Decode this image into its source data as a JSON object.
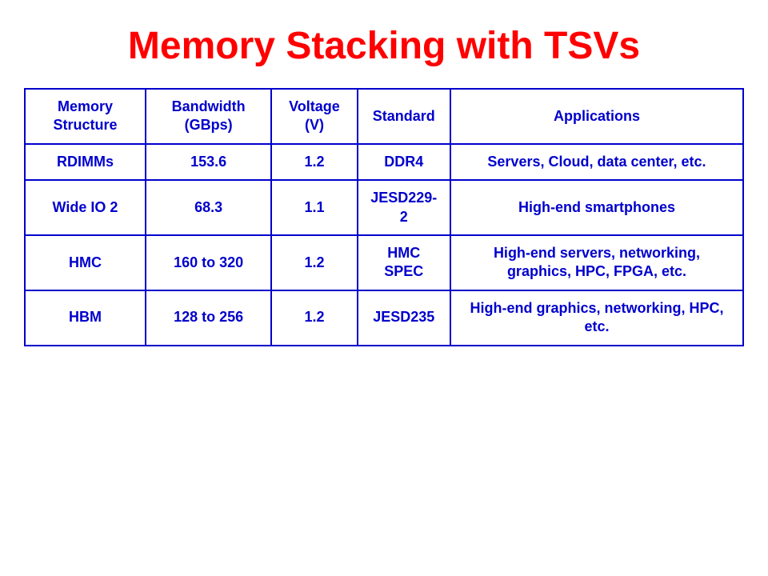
{
  "title": "Memory Stacking with TSVs",
  "table": {
    "headers": [
      "Memory Structure",
      "Bandwidth (GBps)",
      "Voltage (V)",
      "Standard",
      "Applications"
    ],
    "rows": [
      {
        "memory_structure": "RDIMMs",
        "bandwidth": "153.6",
        "voltage": "1.2",
        "standard": "DDR4",
        "applications": "Servers, Cloud, data center, etc."
      },
      {
        "memory_structure": "Wide IO 2",
        "bandwidth": "68.3",
        "voltage": "1.1",
        "standard": "JESD229-2",
        "applications": "High-end smartphones"
      },
      {
        "memory_structure": "HMC",
        "bandwidth": "160 to 320",
        "voltage": "1.2",
        "standard": "HMC SPEC",
        "applications": "High-end servers, networking, graphics, HPC, FPGA, etc."
      },
      {
        "memory_structure": "HBM",
        "bandwidth": "128 to 256",
        "voltage": "1.2",
        "standard": "JESD235",
        "applications": "High-end graphics, networking, HPC, etc."
      }
    ]
  }
}
